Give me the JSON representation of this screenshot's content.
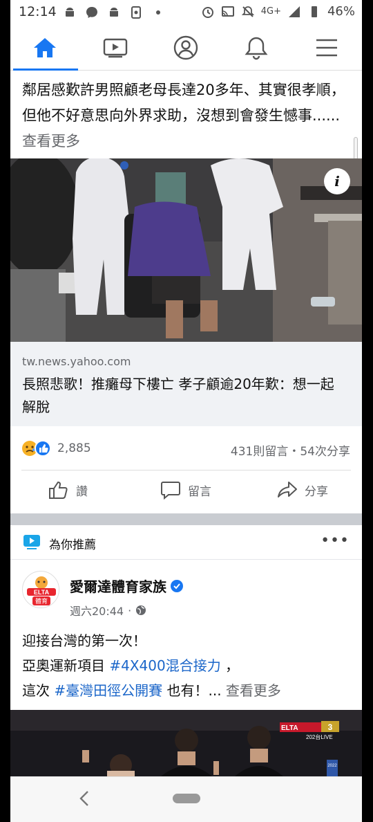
{
  "status_bar": {
    "time": "12:14",
    "network": "4G+",
    "battery": "46%"
  },
  "nav": {
    "tabs": [
      {
        "name": "home",
        "active": true
      },
      {
        "name": "watch",
        "active": false
      },
      {
        "name": "profile",
        "active": false
      },
      {
        "name": "notifications",
        "active": false
      },
      {
        "name": "menu",
        "active": false
      }
    ],
    "accent": "#1877f2"
  },
  "post1": {
    "text": "鄰居感歎許男照顧老母長達20多年、其實很孝順，但他不好意思向外界求助，沒想到會發生憾事......",
    "see_more": "查看更多",
    "link_domain": "tw.news.yahoo.com",
    "link_title": "長照悲歌！推癱母下樓亡 孝子顧逾20年歎：想一起解脫",
    "reaction_count": "2,885",
    "comments_shares": "431則留言・54次分享",
    "actions": {
      "like": "讚",
      "comment": "留言",
      "share": "分享"
    }
  },
  "recommended": {
    "header": "為你推薦",
    "page_name": "愛爾達體育家族",
    "post_time": "週六20:44",
    "post_lines": {
      "line1": "迎接台灣的第一次！",
      "line2_prefix": "亞奧運新項目 ",
      "line2_hashtag": "#4X400混合接力",
      "line2_suffix": " ，",
      "line3_prefix": "這次 ",
      "line3_hashtag": "#臺灣田徑公開賽",
      "line3_suffix": " 也有！... ",
      "see_more": "查看更多"
    },
    "avatar_text": "體育",
    "broadcast_logo": "ELTA",
    "broadcast_channel": "3",
    "broadcast_sub": "202台LIVE",
    "scoreboard_year": "2022"
  }
}
